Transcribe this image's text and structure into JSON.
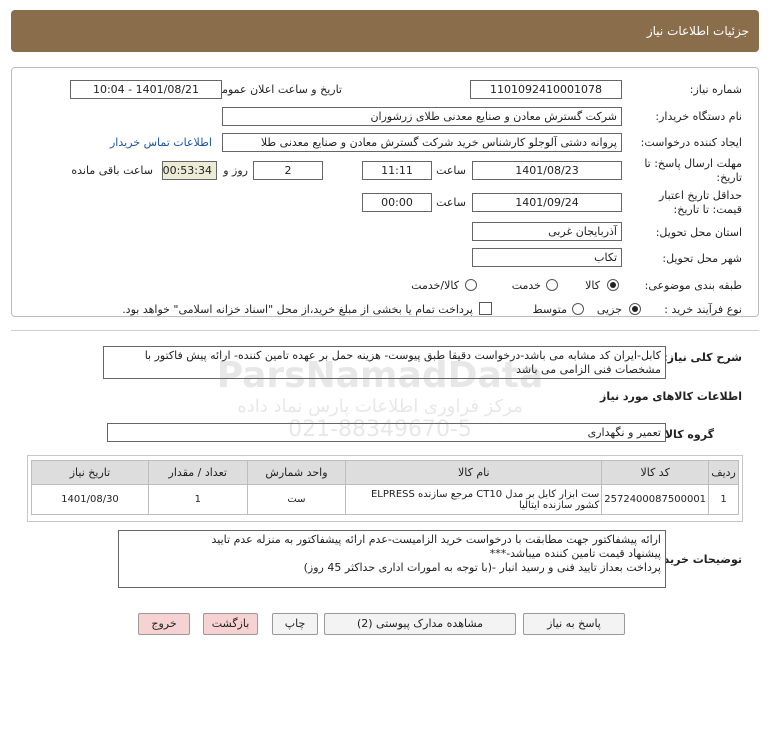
{
  "header": {
    "title": "جزئیات اطلاعات نیاز"
  },
  "form": {
    "need_number_label": "شماره نیاز:",
    "need_number": "1101092410001078",
    "announce_label": "تاریخ و ساعت اعلان عمومی:",
    "announce_value": "1401/08/21 - 10:04",
    "buyer_org_label": "نام دستگاه خریدار:",
    "buyer_org": "شرکت گسترش معادن و صنایع معدنی طلای زرشوران",
    "creator_label": "ایجاد کننده درخواست:",
    "creator": "پروانه  دشتی آلوجلو کارشناس خرید شرکت گسترش معادن و صنایع معدنی طلا",
    "contact_link": "اطلاعات تماس خریدار",
    "deadline_label": "مهلت ارسال پاسخ: تا تاریخ:",
    "deadline_date": "1401/08/23",
    "time_label": "ساعت",
    "deadline_time": "11:11",
    "days": "2",
    "days_label": "روز و",
    "remaining": "00:53:34",
    "remaining_label": "ساعت باقی مانده",
    "validity_label": "حداقل تاریخ اعتبار قیمت: تا تاریخ:",
    "validity_date": "1401/09/24",
    "validity_time": "00:00",
    "province_label": "استان محل تحویل:",
    "province": "آذربایجان غربی",
    "city_label": "شهر محل تحویل:",
    "city": "تکاب",
    "category_label": "طبقه بندی موضوعی:",
    "cat_options": [
      "کالا",
      "خدمت",
      "کالا/خدمت"
    ],
    "process_label": "نوع فرآیند خرید :",
    "process_options": [
      "جزیی",
      "متوسط"
    ],
    "payment_note": "پرداخت تمام یا بخشی از مبلغ خرید،از محل \"اسناد خزانه اسلامی\" خواهد بود."
  },
  "description": {
    "label": "شرح کلی نیاز:",
    "text": "کابل-ایران کد مشابه می باشد-درخواست دقیقا طبق پیوست- هزینه حمل بر عهده تامین کننده- ارائه پیش فاکتور با مشخصات فنی الزامی می باشد"
  },
  "goods": {
    "section_title": "اطلاعات کالاهای مورد نیاز",
    "group_label": "گروه کالا:",
    "group_value": "تعمیر و نگهداری",
    "columns": [
      "ردیف",
      "کد کالا",
      "نام کالا",
      "واحد شمارش",
      "تعداد / مقدار",
      "تاریخ نیاز"
    ],
    "rows": [
      {
        "row": "1",
        "code": "2572400087500001",
        "name": "ست ابزار کابل بر مدل CT10 مرجع سازنده ELPRESS کشور سازنده ایتالیا",
        "unit": "ست",
        "qty": "1",
        "date": "1401/08/30"
      }
    ]
  },
  "buyer_notes": {
    "label": "توضیحات خریدار:",
    "lines": [
      "ارائه پیشفاکتور جهت مطابقت با درخواست خرید الزامیست-عدم ارائه پیشفاکتور به منزله عدم تایید",
      "پیشنهاد قیمت تامین کننده میباشد-***",
      "پرداخت بعداز تایید فنی و رسید انبار -(با توجه به امورات اداری حداکثر 45 روز)"
    ]
  },
  "buttons": {
    "reply": "پاسخ به نیاز",
    "attachments": "مشاهده مدارک پیوستی (2)",
    "print": "چاپ",
    "back": "بازگشت",
    "exit": "خروج"
  },
  "watermark": {
    "line1": "ParsNamadData",
    "line2": "مرکز فراوری اطلاعات پارس نماد داده",
    "line3": "021-88349670-5"
  },
  "colors": {
    "header": "#8a6e4b",
    "link": "#1a55a8",
    "remaining_bg": "#ecebd6",
    "exit_bg": "#f7d2d2"
  }
}
